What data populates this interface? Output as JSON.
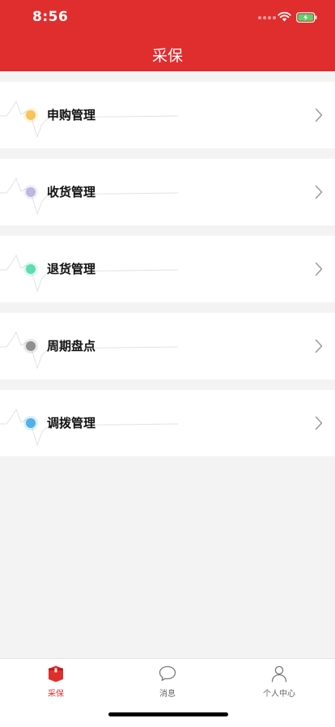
{
  "status_bar": {
    "time": "8:56"
  },
  "header": {
    "title": "采保"
  },
  "menu": {
    "items": [
      {
        "label": "申购管理",
        "dot_color": "#f5c45a"
      },
      {
        "label": "收货管理",
        "dot_color": "#bdb6e3"
      },
      {
        "label": "退货管理",
        "dot_color": "#5fdcb0"
      },
      {
        "label": "周期盘点",
        "dot_color": "#8f8f8f"
      },
      {
        "label": "调拨管理",
        "dot_color": "#4fb1e6"
      }
    ]
  },
  "tabs": [
    {
      "label": "采保",
      "icon": "package-icon",
      "active": true
    },
    {
      "label": "消息",
      "icon": "chat-bubble-icon",
      "active": false
    },
    {
      "label": "个人中心",
      "icon": "person-icon",
      "active": false
    }
  ],
  "colors": {
    "accent": "#e02e2e"
  }
}
